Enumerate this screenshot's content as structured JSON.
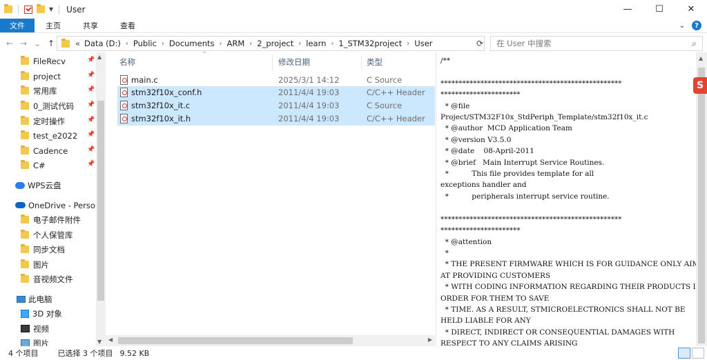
{
  "title": "User",
  "window_controls": {
    "minimize": "—",
    "maximize": "☐",
    "close": "✕"
  },
  "ribbon": {
    "tabs": [
      "文件",
      "主页",
      "共享",
      "查看"
    ]
  },
  "nav_buttons": {
    "back": "←",
    "forward": "→",
    "recent": "⌄",
    "up": "↑"
  },
  "breadcrumb": {
    "more": "«",
    "items": [
      "Data (D:)",
      "Public",
      "Documents",
      "ARM",
      "2_project",
      "learn",
      "1_STM32project",
      "User"
    ]
  },
  "search": {
    "placeholder": "在 User 中搜索"
  },
  "nav": {
    "quick_access": [
      {
        "label": "FileRecv",
        "pinned": true
      },
      {
        "label": "project",
        "pinned": true
      },
      {
        "label": "常用库",
        "pinned": true
      },
      {
        "label": "0_测试代码",
        "pinned": true
      },
      {
        "label": "定时操作",
        "pinned": true
      },
      {
        "label": "test_e2022",
        "pinned": true
      },
      {
        "label": "Cadence",
        "pinned": true
      },
      {
        "label": "C#",
        "pinned": true
      }
    ],
    "wps": "WPS云盘",
    "onedrive": "OneDrive - Persona",
    "onedrive_items": [
      "电子邮件附件",
      "个人保管库",
      "同步文档",
      "图片",
      "音视频文件"
    ],
    "this_pc": "此电脑",
    "pc_items": [
      "3D 对象",
      "视频",
      "图片"
    ]
  },
  "columns": {
    "name": "名称",
    "modified": "修改日期",
    "type": "类型"
  },
  "files": [
    {
      "name": "main.c",
      "modified": "2025/3/1 14:12",
      "type": "C Source",
      "selected": false
    },
    {
      "name": "stm32f10x_conf.h",
      "modified": "2011/4/4 19:03",
      "type": "C/C++ Header",
      "selected": true
    },
    {
      "name": "stm32f10x_it.c",
      "modified": "2011/4/4 19:03",
      "type": "C Source",
      "selected": true
    },
    {
      "name": "stm32f10x_it.h",
      "modified": "2011/4/4 19:03",
      "type": "C/C++ Header",
      "selected": true
    }
  ],
  "preview": {
    "lines": [
      "/**",
      "",
      "**************************************************",
      "**********************",
      "  * @file",
      "Project/STM32F10x_StdPeriph_Template/stm32f10x_it.c",
      "  * @author  MCD Application Team",
      "  * @version V3.5.0",
      "  * @date    08-April-2011",
      "  * @brief   Main Interrupt Service Routines.",
      "  *          This file provides template for all",
      "exceptions handler and",
      "  *          peripherals interrupt service routine.",
      "",
      "**************************************************",
      "**********************",
      "  * @attention",
      "  *",
      "  * THE PRESENT FIRMWARE WHICH IS FOR GUIDANCE ONLY AIMS",
      "AT PROVIDING CUSTOMERS",
      "  * WITH CODING INFORMATION REGARDING THEIR PRODUCTS IN",
      "ORDER FOR THEM TO SAVE",
      "  * TIME. AS A RESULT, STMICROELECTRONICS SHALL NOT BE",
      "HELD LIABLE FOR ANY",
      "  * DIRECT, INDIRECT OR CONSEQUENTIAL DAMAGES WITH",
      "RESPECT TO ANY CLAIMS ARISING"
    ]
  },
  "status": {
    "count": "4 个项目",
    "selected": "已选择 3 个项目",
    "size": "9.52 KB"
  },
  "colors": {
    "accent": "#1979ca",
    "selection": "#cce8ff",
    "folder": "#f2c94c",
    "wps_red": "#e4432d"
  }
}
